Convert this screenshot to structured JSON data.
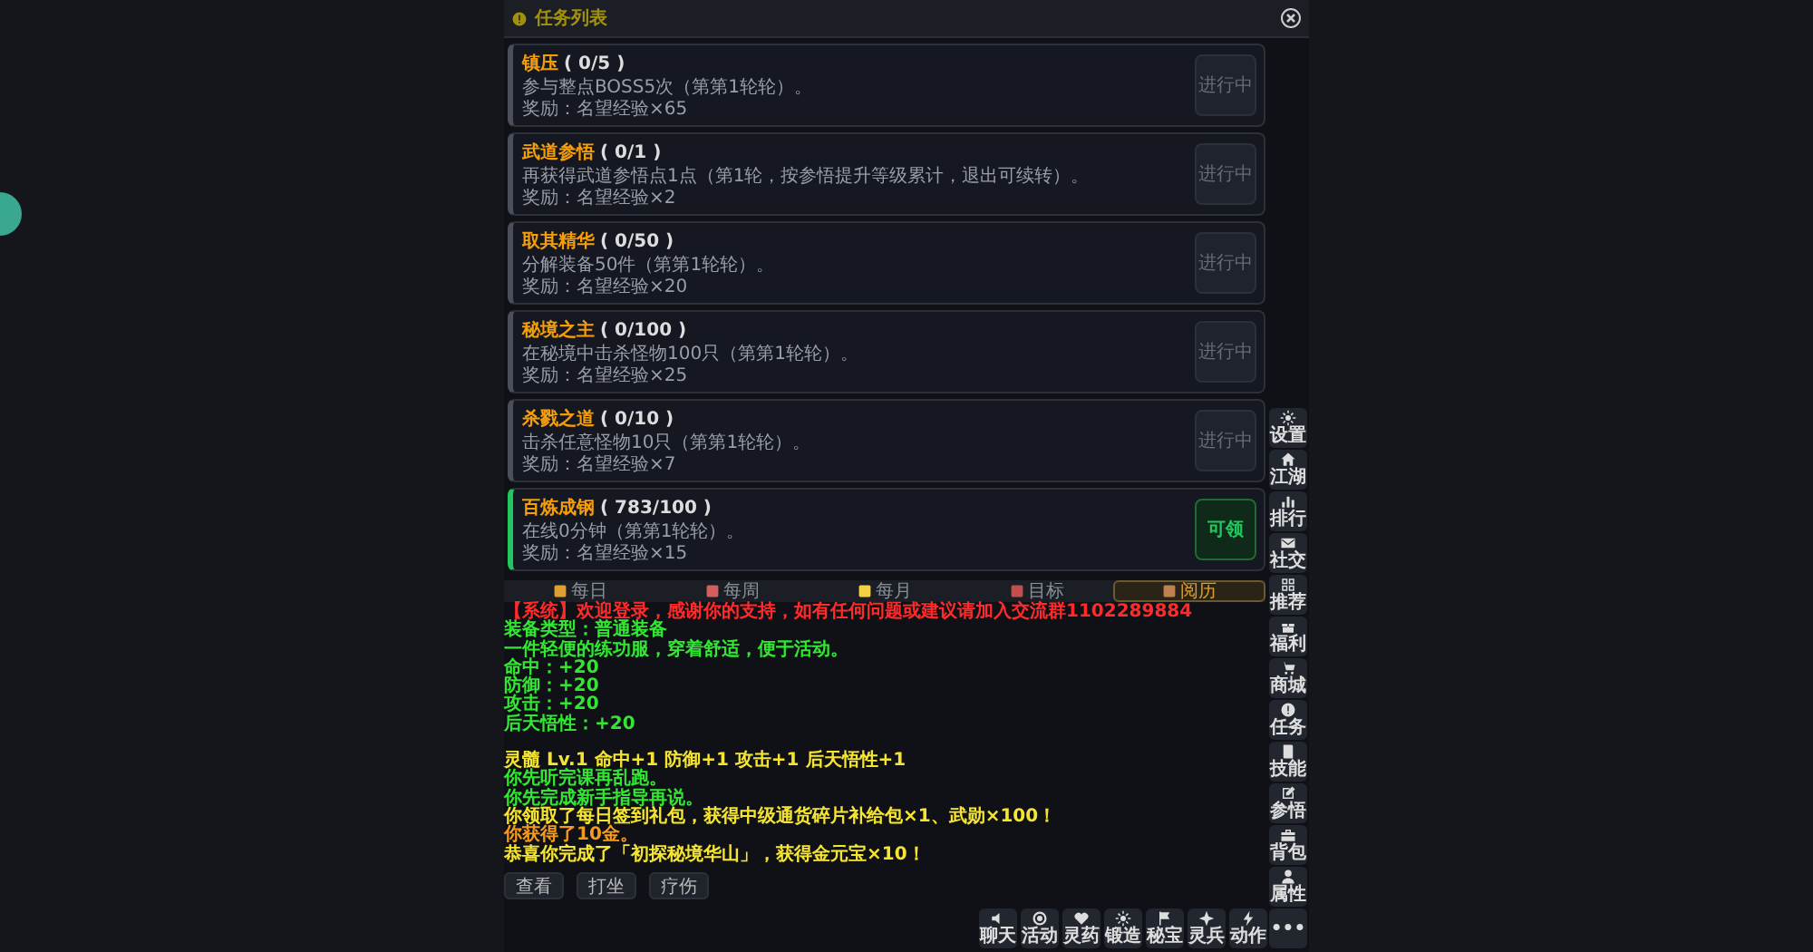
{
  "window": {
    "title": "任务列表"
  },
  "quests": [
    {
      "name": "镇压",
      "progress": "( 0/5 )",
      "desc": "参与整点BOSS5次（第第1轮轮）。",
      "reward": "奖励：名望经验×65",
      "status": "进行中",
      "kind": "in_progress"
    },
    {
      "name": "武道参悟",
      "progress": "( 0/1 )",
      "desc": "再获得武道参悟点1点（第1轮，按参悟提升等级累计，退出可续转）。",
      "reward": "奖励：名望经验×2",
      "status": "进行中",
      "kind": "in_progress"
    },
    {
      "name": "取其精华",
      "progress": "( 0/50 )",
      "desc": "分解装备50件（第第1轮轮）。",
      "reward": "奖励：名望经验×20",
      "status": "进行中",
      "kind": "in_progress"
    },
    {
      "name": "秘境之主",
      "progress": "( 0/100 )",
      "desc": "在秘境中击杀怪物100只（第第1轮轮）。",
      "reward": "奖励：名望经验×25",
      "status": "进行中",
      "kind": "in_progress"
    },
    {
      "name": "杀戮之道",
      "progress": "( 0/10 )",
      "desc": "击杀任意怪物10只（第第1轮轮）。",
      "reward": "奖励：名望经验×7",
      "status": "进行中",
      "kind": "in_progress"
    },
    {
      "name": "百炼成钢",
      "progress": "( 783/100 )",
      "desc": "在线0分钟（第第1轮轮）。",
      "reward": "奖励：名望经验×15",
      "status": "可领",
      "kind": "claimable"
    }
  ],
  "tabs": [
    {
      "label": "每日",
      "selected": false
    },
    {
      "label": "每周",
      "selected": false
    },
    {
      "label": "每月",
      "selected": false
    },
    {
      "label": "目标",
      "selected": false
    },
    {
      "label": "阅历",
      "selected": true
    }
  ],
  "log": [
    {
      "text": "【系统】欢迎登录，感谢你的支持，如有任何问题或建议请加入交流群1102289884",
      "color": "#ff2a2a",
      "gap_before": false
    },
    {
      "text": "装备类型：普通装备",
      "color": "#33e633",
      "gap_before": false
    },
    {
      "text": "一件轻便的练功服，穿着舒适，便于活动。",
      "color": "#33e633",
      "gap_before": false
    },
    {
      "text": "命中：+20",
      "color": "#33e633",
      "gap_before": false
    },
    {
      "text": "防御：+20",
      "color": "#33e633",
      "gap_before": false
    },
    {
      "text": "攻击：+20",
      "color": "#33e633",
      "gap_before": false
    },
    {
      "text": "后天悟性：+20",
      "color": "#33e633",
      "gap_before": false
    },
    {
      "text": "灵髓 Lv.1 命中+1 防御+1 攻击+1 后天悟性+1",
      "color": "#f5e530",
      "gap_before": true
    },
    {
      "text": "你先听完课再乱跑。",
      "color": "#33e633",
      "gap_before": false
    },
    {
      "text": "你先完成新手指导再说。",
      "color": "#33e633",
      "gap_before": false
    },
    {
      "text": "你领取了每日签到礼包，获得中级通货碎片补给包×1、武勋×100！",
      "color": "#f5e530",
      "gap_before": false
    },
    {
      "text": "你获得了10金。",
      "color": "#f59a1a",
      "gap_before": false
    },
    {
      "text": "恭喜你完成了「初探秘境华山」，获得金元宝×10！",
      "color": "#f5e530",
      "gap_before": false
    }
  ],
  "actions": [
    "查看",
    "打坐",
    "疗伤"
  ],
  "side_menu": [
    "设置",
    "江湖",
    "排行",
    "社交",
    "推荐",
    "福利",
    "商城",
    "任务",
    "技能",
    "参悟",
    "背包",
    "属性"
  ],
  "more_button": "•••",
  "bottom_bar": [
    "聊天",
    "活动",
    "灵药",
    "锻造",
    "秘宝",
    "灵兵",
    "动作"
  ]
}
